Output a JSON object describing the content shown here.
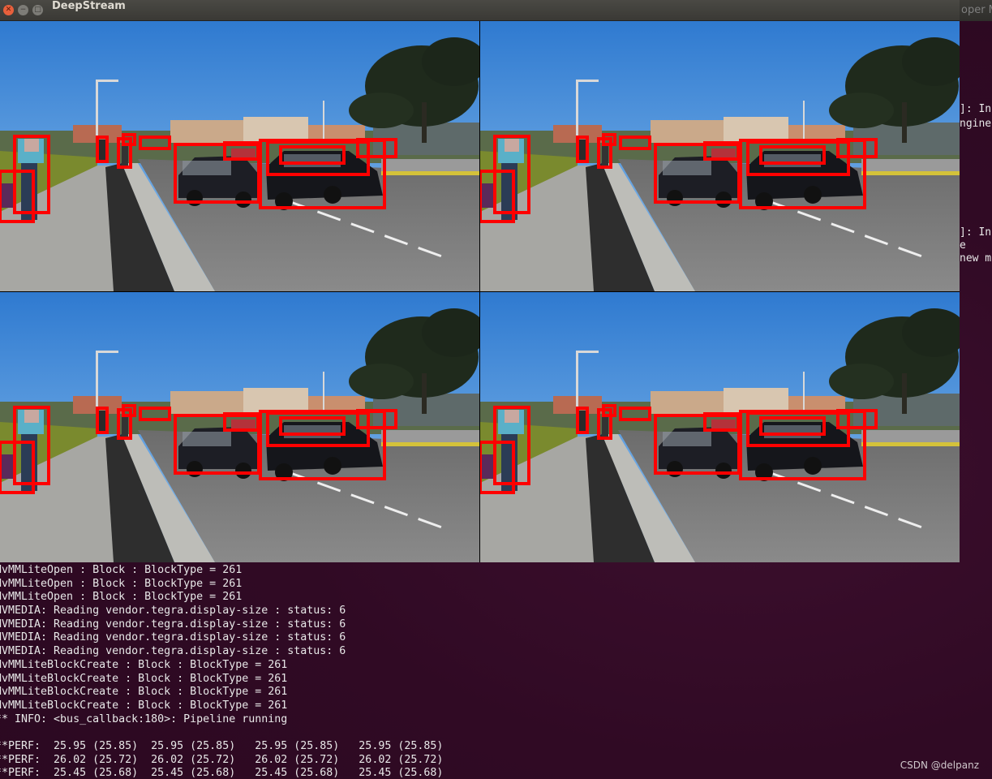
{
  "window": {
    "title": "DeepStream"
  },
  "terminal": {
    "title_fragment": "oper M",
    "right_fragments": [
      "]: In",
      "ngine",
      "]: In",
      "e",
      "new m"
    ],
    "lines": [
      "NvMMLiteOpen : Block : BlockType = 261",
      "NvMMLiteOpen : Block : BlockType = 261",
      "NvMMLiteOpen : Block : BlockType = 261",
      "NVMEDIA: Reading vendor.tegra.display-size : status: 6",
      "NVMEDIA: Reading vendor.tegra.display-size : status: 6",
      "NVMEDIA: Reading vendor.tegra.display-size : status: 6",
      "NVMEDIA: Reading vendor.tegra.display-size : status: 6",
      "NvMMLiteBlockCreate : Block : BlockType = 261",
      "NvMMLiteBlockCreate : Block : BlockType = 261",
      "NvMMLiteBlockCreate : Block : BlockType = 261",
      "NvMMLiteBlockCreate : Block : BlockType = 261",
      "** INFO: <bus_callback:180>: Pipeline running",
      "",
      "**PERF:  25.95 (25.85)  25.95 (25.85)   25.95 (25.85)   25.95 (25.85)",
      "**PERF:  26.02 (25.72)  26.02 (25.72)   26.02 (25.72)   26.02 (25.72)",
      "**PERF:  25.45 (25.68)  25.45 (25.68)   25.45 (25.68)   25.45 (25.68)"
    ]
  },
  "watermark": "CSDN @delpanz",
  "colors": {
    "detection_box": "#ff0000",
    "terminal_bg": "#300a24",
    "sky": "#3a86d8",
    "road": "#7a7a7a"
  },
  "video_tiles": [
    "stream-0",
    "stream-1",
    "stream-2",
    "stream-3"
  ]
}
